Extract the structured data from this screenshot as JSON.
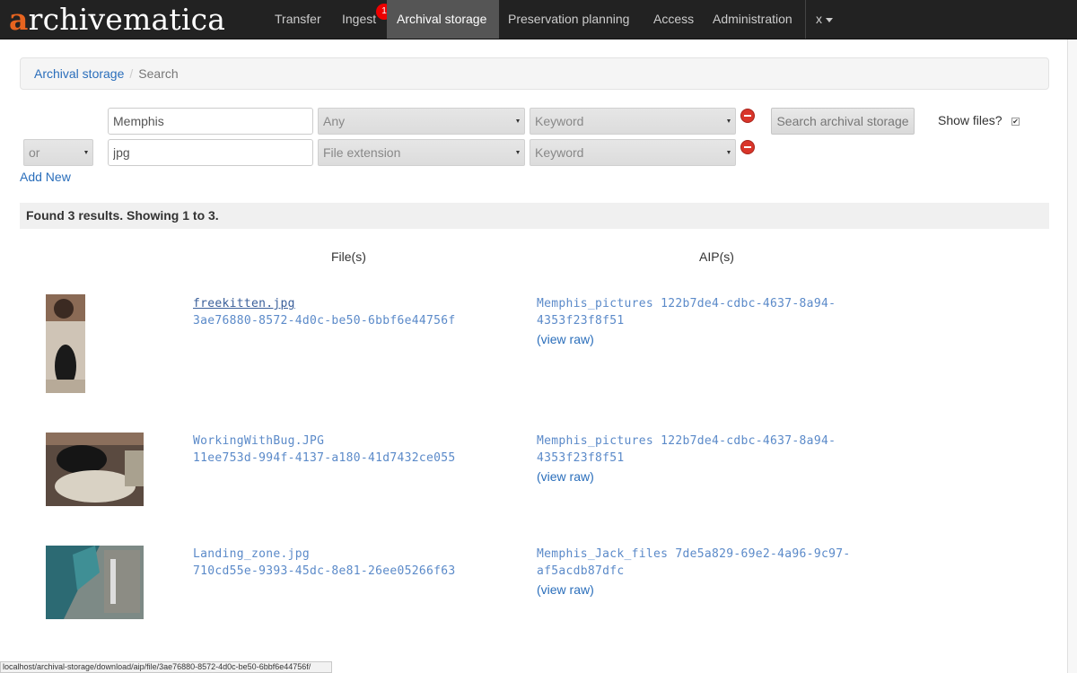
{
  "navbar": {
    "brand_first": "a",
    "brand_rest": "rchivematica",
    "items": [
      {
        "label": "Transfer"
      },
      {
        "label": "Ingest",
        "badge": "1"
      },
      {
        "label": "Archival storage"
      },
      {
        "label": "Preservation planning"
      },
      {
        "label": "Access"
      },
      {
        "label": "Administration"
      }
    ],
    "user_menu": "x"
  },
  "breadcrumb": {
    "link": "Archival storage",
    "separator": "/",
    "current": "Search"
  },
  "search": {
    "rows": [
      {
        "term": "Memphis",
        "field": "Any",
        "type": "Keyword"
      },
      {
        "op": "or",
        "term": "jpg",
        "field": "File extension",
        "type": "Keyword"
      }
    ],
    "search_button": "Search archival storage",
    "show_files_label": "Show files?",
    "show_files_checked": true,
    "add_new": "Add New"
  },
  "results": {
    "summary": "Found 3 results. Showing 1 to 3.",
    "col_files": "File(s)",
    "col_aips": "AIP(s)",
    "items": [
      {
        "filename": "freekitten.jpg",
        "uuid": "3ae76880-8572-4d0c-be50-6bbf6e44756f",
        "aip_line1": "Memphis_pictures 122b7de4-cdbc-4637-8a94-",
        "aip_line2": "4353f23f8f51",
        "view_raw": "(view raw)"
      },
      {
        "filename": "WorkingWithBug.JPG",
        "uuid": "11ee753d-994f-4137-a180-41d7432ce055",
        "aip_line1": "Memphis_pictures 122b7de4-cdbc-4637-8a94-",
        "aip_line2": "4353f23f8f51",
        "view_raw": "(view raw)"
      },
      {
        "filename": "Landing_zone.jpg",
        "uuid": "710cd55e-9393-45dc-8e81-26ee05266f63",
        "aip_line1": "Memphis_Jack_files 7de5a829-69e2-4a96-9c97-",
        "aip_line2": "af5acdb87dfc",
        "view_raw": "(view raw)"
      }
    ]
  },
  "status_url": "localhost/archival-storage/download/aip/file/3ae76880-8572-4d0c-be50-6bbf6e44756f/",
  "colors": {
    "brand_orange": "#e7641f",
    "link": "#2a6ebb",
    "remove_red": "#d9352a",
    "notification": "#ee0000"
  }
}
